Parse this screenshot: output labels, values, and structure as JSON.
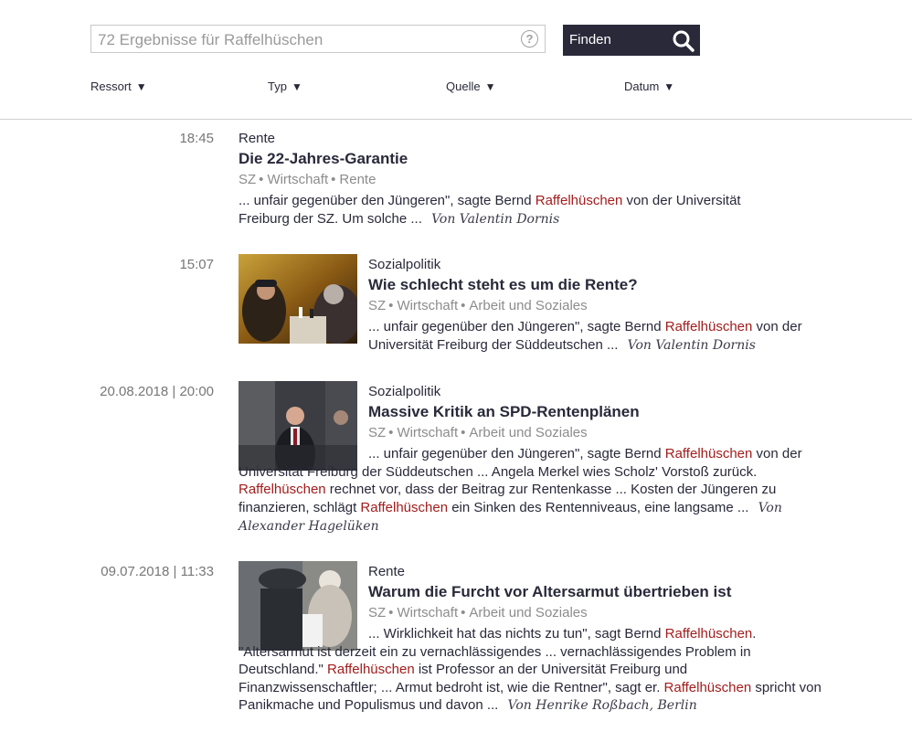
{
  "search": {
    "placeholder": "72 Ergebnisse für Raffelhüschen",
    "help": "?",
    "button_label": "Finden"
  },
  "filters": [
    {
      "label": "Ressort"
    },
    {
      "label": "Typ"
    },
    {
      "label": "Quelle"
    },
    {
      "label": "Datum"
    }
  ],
  "results": [
    {
      "time": "18:45",
      "ressort": "Rente",
      "title": "Die 22-Jahres-Garantie",
      "meta": [
        "SZ",
        "Wirtschaft",
        "Rente"
      ],
      "snippet": [
        {
          "t": "... unfair gegenüber den Jüngeren\", sagte Bernd "
        },
        {
          "t": "Raffelhüschen",
          "hl": true
        },
        {
          "t": " von der Universität Freiburg der SZ. Um solche ... "
        }
      ],
      "author": "Von Valentin Dornis"
    },
    {
      "time": "15:07",
      "ressort": "Sozialpolitik",
      "title": "Wie schlecht steht es um die Rente?",
      "meta": [
        "SZ",
        "Wirtschaft",
        "Arbeit und Soziales"
      ],
      "snippet": [
        {
          "t": "... unfair gegenüber den Jüngeren\", sagte Bernd "
        },
        {
          "t": "Raffelhüschen",
          "hl": true
        },
        {
          "t": " von der Universität Freiburg der Süddeutschen ... "
        }
      ],
      "author": "Von Valentin Dornis"
    },
    {
      "time": "20.08.2018 | 20:00",
      "ressort": "Sozialpolitik",
      "title": "Massive Kritik an SPD-Rentenplänen",
      "meta": [
        "SZ",
        "Wirtschaft",
        "Arbeit und Soziales"
      ],
      "snippet": [
        {
          "t": "... unfair gegenüber den Jüngeren\", sagte Bernd "
        },
        {
          "t": "Raffelhüschen",
          "hl": true
        },
        {
          "t": " von der Universität Freiburg der Süddeutschen ... Angela Merkel wies Scholz' Vorstoß zurück. "
        },
        {
          "t": "Raffelhüschen",
          "hl": true
        },
        {
          "t": " rechnet vor, dass der Beitrag zur Rentenkasse ... Kosten der Jüngeren zu finanzieren, schlägt "
        },
        {
          "t": "Raffelhüschen",
          "hl": true
        },
        {
          "t": " ein Sinken des Rentenniveaus, eine langsame ... "
        }
      ],
      "author": "Von Alexander Hagelüken"
    },
    {
      "time": "09.07.2018 | 11:33",
      "ressort": "Rente",
      "title": "Warum die Furcht vor Altersarmut übertrieben ist",
      "meta": [
        "SZ",
        "Wirtschaft",
        "Arbeit und Soziales"
      ],
      "snippet": [
        {
          "t": "... Wirklichkeit hat das nichts zu tun\", sagt Bernd "
        },
        {
          "t": "Raffelhüschen",
          "hl": true
        },
        {
          "t": ". \"Altersarmut ist derzeit ein zu vernachlässigendes ... vernachlässigendes Problem in Deutschland.\" "
        },
        {
          "t": "Raffelhüschen",
          "hl": true
        },
        {
          "t": " ist Professor an der Universität Freiburg und Finanzwissenschaftler; ... Armut bedroht ist, wie die Rentner\", sagt er. "
        },
        {
          "t": "Raffelhüschen",
          "hl": true
        },
        {
          "t": " spricht von Panikmache und Populismus und davon ... "
        }
      ],
      "author": "Von Henrike Roßbach, Berlin"
    }
  ]
}
